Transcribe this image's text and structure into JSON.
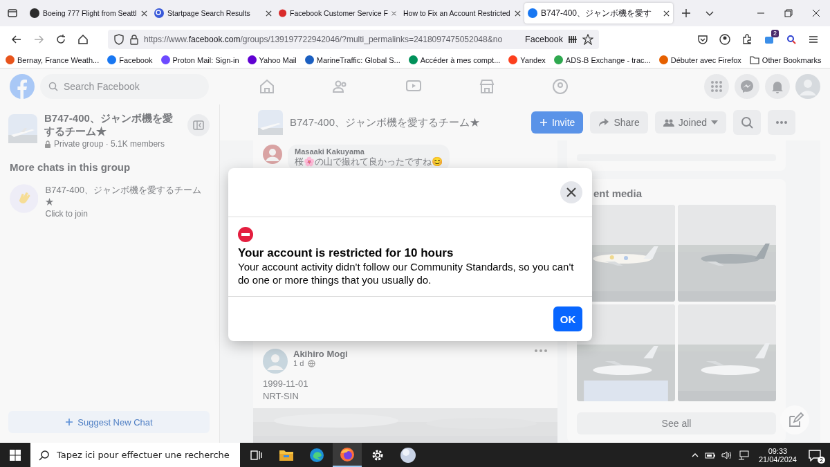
{
  "browser": {
    "tabs": [
      {
        "title": "Boeing 777 Flight from Seattl",
        "kind": "alien",
        "selected": false
      },
      {
        "title": "Startpage Search Results",
        "kind": "search",
        "selected": false
      },
      {
        "title": "Facebook Customer Service F",
        "kind": "red",
        "selected": false
      },
      {
        "title": "How to Fix an Account Restricted",
        "kind": "plain",
        "selected": false
      },
      {
        "title": "B747-400、ジャンボ機を愛す",
        "kind": "facebook",
        "selected": true
      }
    ],
    "url": {
      "scheme": "https://www.",
      "domain": "facebook.com",
      "path": "/groups/139197722942046/?multi_permalinks=2418097475052048&no"
    },
    "site_label": "Facebook",
    "extension_badge": "2",
    "bookmarks": [
      {
        "label": "Bernay, France Weath...",
        "color": "#e8541c"
      },
      {
        "label": "Facebook",
        "color": "#1877f2"
      },
      {
        "label": "Proton Mail: Sign-in",
        "color": "#6d4aff"
      },
      {
        "label": "Yahoo Mail",
        "color": "#6001d2"
      },
      {
        "label": "MarineTraffic: Global S...",
        "color": "#1b5fc1"
      },
      {
        "label": "Accéder à mes compt...",
        "color": "#00915a"
      },
      {
        "label": "Yandex",
        "color": "#fc3f1d"
      },
      {
        "label": "ADS-B Exchange - trac...",
        "color": "#2fa84f"
      },
      {
        "label": "Débuter avec Firefox",
        "color": "#e66000"
      }
    ],
    "other_bookmarks": "Other Bookmarks"
  },
  "facebook": {
    "search": {
      "placeholder": "Search Facebook"
    },
    "sidebar": {
      "group_name": "B747-400、ジャンボ機を愛するチーム★",
      "group_meta": "Private group · 5.1K members",
      "section_title": "More chats in this group",
      "chats": [
        {
          "name": "B747-400、ジャンボ機を愛するチーム★",
          "status": "Click to join"
        }
      ],
      "suggest_button": "Suggest New Chat"
    },
    "header": {
      "title": "B747-400、ジャンボ機を愛するチーム★",
      "buttons": [
        {
          "label": "Invite",
          "kind": "primary"
        },
        {
          "label": "Share",
          "kind": "share"
        },
        {
          "label": "Joined",
          "kind": "joined"
        }
      ]
    },
    "comment": {
      "author": "Masaaki Kakuyama",
      "text": "桜🌸の山で撮れて良かったですね😊"
    },
    "post": {
      "author": "Akihiro Mogi",
      "time": "1 d",
      "lines": [
        "1999-11-01",
        "NRT-SIN"
      ]
    },
    "media": {
      "title": "ent media",
      "see_all": "See all"
    }
  },
  "modal": {
    "title": "Your account is restricted for 10 hours",
    "body": "Your account activity didn't follow our Community Standards, so you can't do one or more things that you usually do.",
    "ok": "OK"
  },
  "taskbar": {
    "search_placeholder": "Tapez ici pour effectuer une recherche",
    "time": "09:33",
    "date": "21/04/2024",
    "notifications": "2",
    "apps": [
      {
        "kind": "taskview",
        "selected": false
      },
      {
        "kind": "explorer",
        "selected": false
      },
      {
        "kind": "edge",
        "selected": false
      },
      {
        "kind": "firefox",
        "selected": true
      },
      {
        "kind": "settings",
        "selected": false
      },
      {
        "kind": "sphere",
        "selected": false
      }
    ]
  }
}
